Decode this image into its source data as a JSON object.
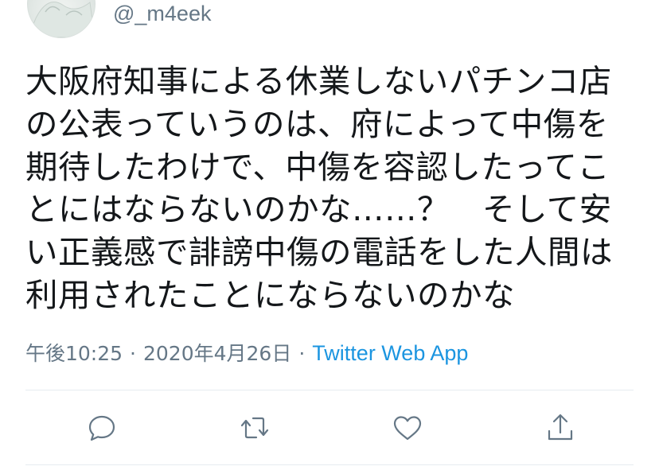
{
  "user": {
    "handle": "@_m4eek"
  },
  "tweet": {
    "text": "大阪府知事による休業しないパチンコ店の公表っていうのは、府によって中傷を期待したわけで、中傷を容認したってことにはならないのかな……？　そして安い正義感で誹謗中傷の電話をした人間は利用されたことにならないのかな",
    "lines": [
      "大阪府知事による休業しないパチンコ店",
      "の公表っていうのは、府によって中傷を",
      "期待したわけで、中傷を容認したってこ",
      "とにはならないのかな……？　そして安",
      "い正義感で誹謗中傷の電話をした人間は",
      "利用されたことにならないのかな"
    ]
  },
  "meta": {
    "time": "午後10:25",
    "separator": "·",
    "date": "2020年4月26日",
    "source": "Twitter Web App"
  },
  "actions": {
    "reply_icon": "reply-icon",
    "retweet_icon": "retweet-icon",
    "like_icon": "like-icon",
    "share_icon": "share-icon"
  },
  "colors": {
    "text": "#14171a",
    "secondary": "#657786",
    "link": "#1b95e0",
    "divider": "#e6ecf0"
  }
}
